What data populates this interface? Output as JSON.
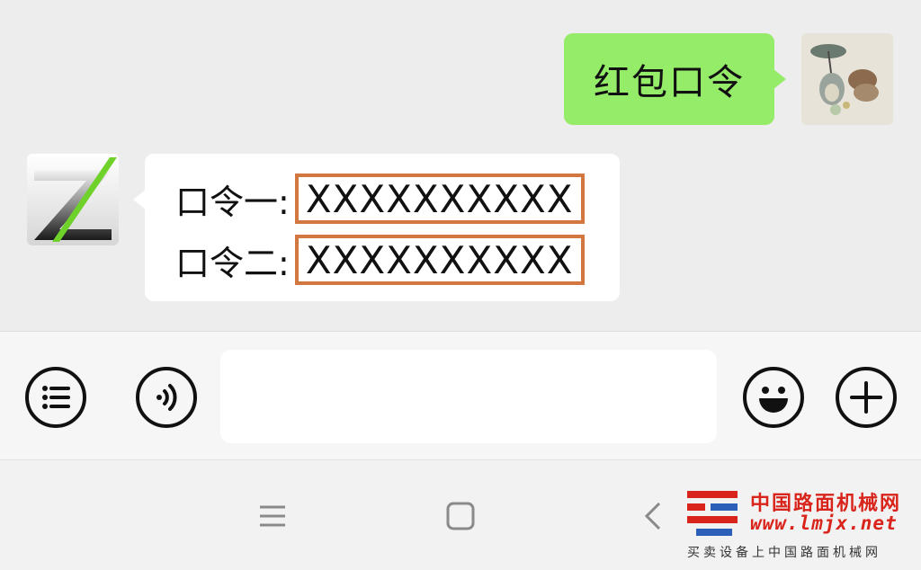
{
  "chat": {
    "my_message": "红包口令",
    "reply": {
      "row1_label": "口令一:",
      "row1_value": "XXXXXXXXXX",
      "row2_label": "口令二:",
      "row2_value": "XXXXXXXXXX"
    }
  },
  "input_bar": {
    "text_value": "",
    "icons": [
      "menu-list-icon",
      "voice-icon",
      "emoji-icon",
      "plus-icon"
    ]
  },
  "nav_bar": {
    "icons": [
      "recent-apps-icon",
      "home-icon",
      "back-icon"
    ]
  },
  "watermark": {
    "name": "中国路面机械网",
    "url": "www.lmjx.net",
    "slogan": "买卖设备上中国路面机械网",
    "color": "#d9241b"
  },
  "colors": {
    "my_bubble": "#95ec69",
    "other_bubble": "#ffffff",
    "highlight_box": "#d2773f",
    "background": "#ededed"
  }
}
